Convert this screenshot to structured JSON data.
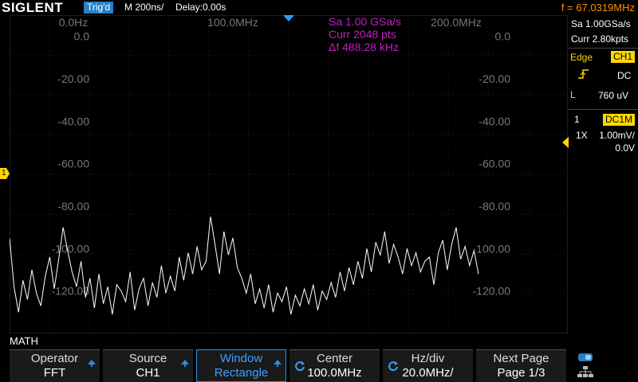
{
  "topbar": {
    "brand": "SIGLENT",
    "trigger_status": "Trig'd",
    "timebase": "M 200ns/",
    "delay": "Delay:0.00s",
    "frequency": "f = 67.0319MHz"
  },
  "plot": {
    "x_labels": [
      "0.0Hz",
      "100.0MHz",
      "200.0MHz"
    ],
    "y_labels": [
      "0.0",
      "-20.00",
      "-40.00",
      "-60.00",
      "-80.00",
      "-100.00",
      "-120.00"
    ],
    "info": [
      "Sa 1.00 GSa/s",
      "Curr 2048 pts",
      "Δf 488.28 kHz"
    ],
    "ch_marker": "1",
    "colors": {
      "trace": "#ffffff",
      "grid": "#2a2a2a",
      "info": "#c020c0",
      "ch1": "#ffd700"
    }
  },
  "chart_data": {
    "type": "line",
    "title": "",
    "xlabel": "",
    "ylabel": "",
    "xlim": [
      0,
      250
    ],
    "ylim": [
      -140,
      10
    ],
    "x_ticks": [
      "0.0Hz",
      "100.0MHz",
      "200.0MHz"
    ],
    "y_ticks": [
      "0.0",
      "-20.00",
      "-40.00",
      "-60.00",
      "-80.00",
      "-100.00",
      "-120.00"
    ],
    "series": [
      {
        "x": [
          0,
          2,
          4,
          6,
          8,
          10,
          12,
          14,
          16,
          18,
          20,
          22,
          24,
          26,
          28,
          30,
          32,
          34,
          36,
          38,
          40,
          42,
          44,
          46,
          48,
          50,
          52,
          54,
          56,
          58,
          60,
          62,
          64,
          66,
          68,
          70,
          72,
          74,
          76,
          78,
          80,
          82,
          84,
          86,
          88,
          90,
          92,
          94,
          96,
          98,
          100,
          102,
          104,
          106,
          108,
          110,
          112,
          114,
          116,
          118,
          120,
          122,
          124,
          126,
          128,
          130,
          132,
          134,
          136,
          138,
          140,
          142,
          144,
          146,
          148,
          150,
          152,
          154,
          156,
          158,
          160,
          162,
          164,
          166,
          168,
          170,
          172,
          174,
          176,
          178,
          180,
          182,
          184,
          186,
          188,
          190,
          192,
          194,
          196,
          198,
          200,
          202,
          204,
          206,
          208,
          210
        ],
        "values": [
          -95,
          -118,
          -130,
          -115,
          -124,
          -110,
          -121,
          -127,
          -113,
          -104,
          -119,
          -105,
          -90,
          -101,
          -111,
          -118,
          -106,
          -123,
          -114,
          -128,
          -112,
          -126,
          -118,
          -131,
          -117,
          -120,
          -125,
          -111,
          -129,
          -119,
          -114,
          -127,
          -116,
          -123,
          -108,
          -121,
          -113,
          -120,
          -104,
          -115,
          -102,
          -112,
          -99,
          -110,
          -106,
          -85,
          -98,
          -112,
          -92,
          -103,
          -95,
          -109,
          -114,
          -121,
          -112,
          -126,
          -119,
          -128,
          -117,
          -130,
          -121,
          -125,
          -118,
          -131,
          -122,
          -127,
          -119,
          -126,
          -117,
          -129,
          -120,
          -124,
          -116,
          -123,
          -111,
          -120,
          -109,
          -117,
          -106,
          -114,
          -100,
          -111,
          -97,
          -103,
          -92,
          -107,
          -98,
          -104,
          -112,
          -100,
          -108,
          -102,
          -111,
          -106,
          -104,
          -117,
          -102,
          -96,
          -110,
          -98,
          -90,
          -105,
          -99,
          -108,
          -101,
          -112
        ]
      }
    ]
  },
  "panel": {
    "sample_rate": "Sa 1.00GSa/s",
    "current_points": "Curr 2.80kpts",
    "trigger_type": "Edge",
    "trigger_source": "CH1",
    "coupling": "DC",
    "level_label": "L",
    "level_value": "760 uV",
    "ch_number": "1",
    "ch_coupling_badge": "DC1M",
    "probe": "1X",
    "scale": "1.00mV/",
    "offset": "0.0V"
  },
  "math_label": "MATH",
  "softkeys": [
    {
      "title": "Operator",
      "value": "FFT"
    },
    {
      "title": "Source",
      "value": "CH1"
    },
    {
      "title": "Window",
      "value": "Rectangle"
    },
    {
      "title": "Center",
      "value": "100.0MHz"
    },
    {
      "title": "Hz/div",
      "value": "20.0MHz/"
    },
    {
      "title": "Next Page",
      "value": "Page 1/3"
    }
  ]
}
